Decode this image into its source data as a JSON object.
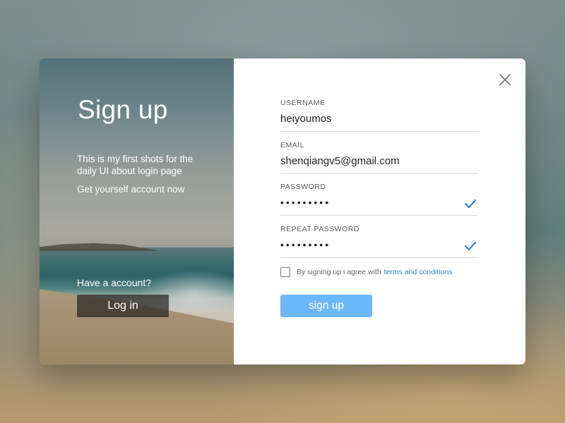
{
  "left_panel": {
    "title": "Sign up",
    "description": "This is my first shots for the daily UI about login page",
    "subtitle": "Get yourself account now",
    "have_account": "Have a account?",
    "login_label": "Log in"
  },
  "form": {
    "username": {
      "label": "USERNAME",
      "value": "heiyoumos"
    },
    "email": {
      "label": "EMAIL",
      "value": "shenqiangv5@gmail.com"
    },
    "password": {
      "label": "PASSWORD",
      "value": "•••••••••",
      "valid": true
    },
    "repeat_password": {
      "label": "REPEAT PASSWORD",
      "value": "•••••••••",
      "valid": true
    },
    "agree_text": "By signing up i agree with",
    "terms_link": "terms and conditions",
    "agree_checked": false,
    "submit_label": "sign up"
  },
  "icons": {
    "close": "close-icon",
    "check": "check-icon"
  },
  "colors": {
    "accent": "#6cb7fb",
    "link": "#2f84d6",
    "check": "#2f84d6",
    "login_button": "#3a3632"
  }
}
